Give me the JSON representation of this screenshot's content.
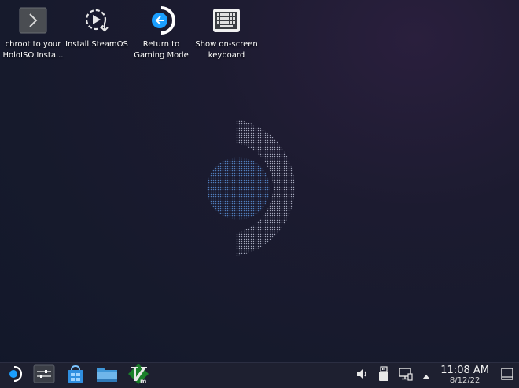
{
  "desktop": {
    "icons": [
      {
        "label_line1": "chroot to your",
        "label_line2": "HoloISO Insta...",
        "icon": "terminal-chevron-icon"
      },
      {
        "label_line1": "Install SteamOS",
        "label_line2": "",
        "icon": "install-steamos-icon"
      },
      {
        "label_line1": "Return to",
        "label_line2": "Gaming Mode",
        "icon": "return-gaming-mode-icon"
      },
      {
        "label_line1": "Show on-screen",
        "label_line2": "keyboard",
        "icon": "keyboard-icon"
      }
    ]
  },
  "taskbar": {
    "launcher_icon": "steamos-launcher-icon",
    "tasks": [
      {
        "icon": "task-manager-icon"
      },
      {
        "icon": "discover-store-icon"
      },
      {
        "icon": "file-manager-icon"
      },
      {
        "icon": "vim-icon"
      }
    ],
    "tray": {
      "volume_icon": "volume-icon",
      "storage_icon": "removable-storage-icon",
      "network_icon": "network-icon",
      "expand_icon": "tray-expand-icon"
    },
    "clock": {
      "time": "11:08 AM",
      "date": "8/12/22"
    },
    "show_desktop_icon": "show-desktop-icon"
  },
  "colors": {
    "accent": "#1a9fff",
    "taskbar_bg": "#1e2030"
  }
}
